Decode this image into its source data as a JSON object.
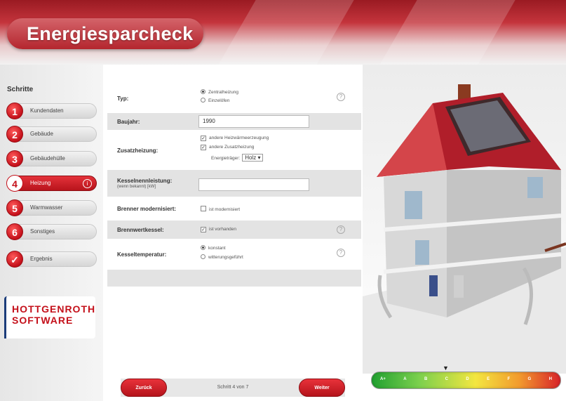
{
  "header": {
    "title": "Energiesparcheck"
  },
  "steps": {
    "title": "Schritte",
    "items": [
      {
        "num": "1",
        "label": "Kundendaten"
      },
      {
        "num": "2",
        "label": "Gebäude"
      },
      {
        "num": "3",
        "label": "Gebäudehülle"
      },
      {
        "num": "4",
        "label": "Heizung",
        "active": true,
        "info": "i"
      },
      {
        "num": "5",
        "label": "Warmwasser"
      },
      {
        "num": "6",
        "label": "Sonstiges"
      },
      {
        "num": "✓",
        "label": "Ergebnis"
      }
    ],
    "logo_line1": "HOTTGENROTH",
    "logo_line2": "SOFTWARE"
  },
  "form": {
    "typ": {
      "label": "Typ:",
      "options": [
        "Zentralheizung",
        "Einzelöfen"
      ],
      "selected": 0
    },
    "baujahr": {
      "label": "Baujahr:",
      "value": "1990"
    },
    "zusatzheizung": {
      "label": "Zusatzheizung:",
      "opt1": "andere Heizwärmeerzeugung",
      "opt2": "andere Zusatzheizung",
      "energietraeger_label": "Energieträger:",
      "energietraeger_value": "Holz"
    },
    "kesselnennleistung": {
      "label": "Kesselnennleistung:",
      "sublabel": "(wenn bekannt) [kW]",
      "value": ""
    },
    "brenner": {
      "label": "Brenner modernisiert:",
      "option": "ist modernisiert"
    },
    "brennwertkessel": {
      "label": "Brennwertkessel:",
      "option": "ist vorhanden"
    },
    "kesseltemperatur": {
      "label": "Kesseltemperatur:",
      "options": [
        "konstant",
        "witterungsgeführt"
      ],
      "selected": 0
    },
    "help": "?"
  },
  "nav": {
    "back": "Zurück",
    "next": "Weiter",
    "step_info": "Schritt 4 von 7"
  },
  "scale": {
    "labels": [
      "A+",
      "A",
      "B",
      "C",
      "D",
      "E",
      "F",
      "G",
      "H"
    ],
    "colors": [
      "#21a030",
      "#7bd04d",
      "#f3e640",
      "#f29b2e",
      "#d8232a"
    ]
  }
}
